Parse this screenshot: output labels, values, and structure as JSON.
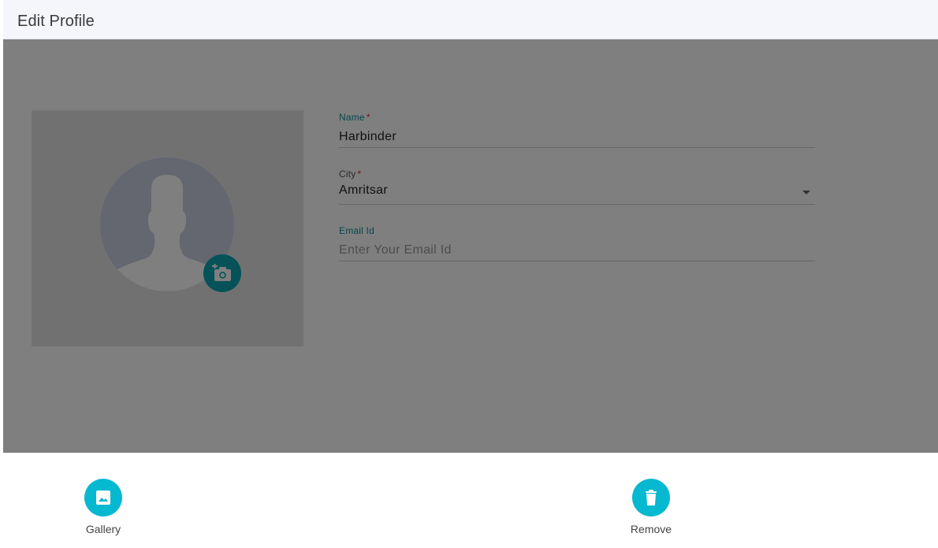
{
  "header": {
    "title": "Edit Profile"
  },
  "profile": {
    "photo_icon": "person-silhouette-icon",
    "camera_icon": "add-photo-icon"
  },
  "form": {
    "name": {
      "label": "Name",
      "required_mark": "*",
      "value": "Harbinder"
    },
    "city": {
      "label": "City",
      "required_mark": "*",
      "value": "Amritsar"
    },
    "email": {
      "label": "Email Id",
      "placeholder": "Enter Your Email Id",
      "value": ""
    }
  },
  "action_sheet": {
    "gallery": {
      "label": "Gallery",
      "icon": "image-icon"
    },
    "remove": {
      "label": "Remove",
      "icon": "trash-icon"
    }
  },
  "colors": {
    "accent": "#0aa4b3",
    "action": "#06b8d0",
    "required": "#d0312d"
  }
}
